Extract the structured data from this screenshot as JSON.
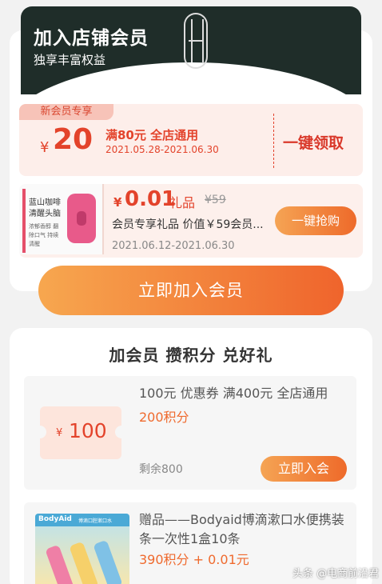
{
  "banner": {
    "title": "加入店铺会员",
    "subtitle": "独享丰富权益",
    "logo": "brand-logo-icon"
  },
  "new_member_coupon": {
    "tag": "新会员专享",
    "currency": "¥",
    "amount": "20",
    "condition": "满80元 全店通用",
    "date_range": "2021.05.28-2021.06.30",
    "claim_label": "一键领取"
  },
  "member_gift": {
    "image_text_line1": "蓝山咖啡",
    "image_text_line2": "清醒头脑",
    "image_text_small": "浓郁香醇 翻除口气 持续清醒",
    "currency": "¥",
    "price": "0.01",
    "type": "礼品",
    "original_price": "¥59",
    "name": "会员专享礼品 价值￥59会员...",
    "date_range": "2021.06.12-2021.06.30",
    "button_label": "一键抢购"
  },
  "join_button": "立即加入会员",
  "points_section": {
    "title": "加会员 攒积分 兑好礼",
    "items": [
      {
        "voucher_currency": "¥",
        "voucher_amount": "100",
        "name": "100元 优惠券 满400元 全店通用",
        "points": "200积分",
        "remaining": "剩余800",
        "button_label": "立即入会"
      },
      {
        "image_brand": "BodyAid",
        "image_sub": "博滴口腔漱口水",
        "name": "赠品——Bodyaid博滴漱口水便携装条一次性1盒10条",
        "points": "390积分 + 0.01元"
      }
    ]
  },
  "watermark": "头条 @电商前沿君",
  "colors": {
    "accent": "#ef6a2e",
    "price_red": "#e3432b",
    "banner_bg": "#1f2d29"
  }
}
